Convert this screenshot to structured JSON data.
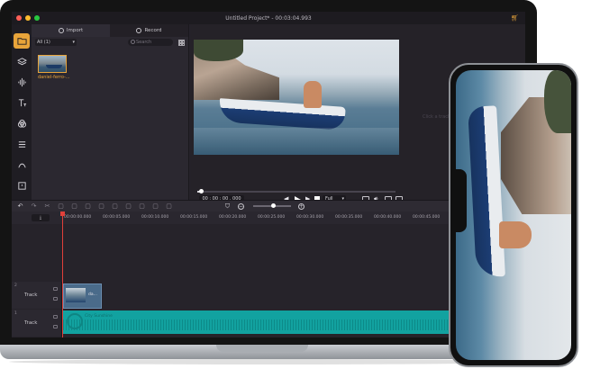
{
  "window": {
    "title": "Untitled Project* - 00:03:04.993"
  },
  "rail": {
    "items": [
      "folder-icon",
      "layers-icon",
      "audio-icon",
      "text-icon",
      "filters-icon",
      "transitions-icon",
      "elements-icon",
      "sticker-icon",
      "template-icon"
    ]
  },
  "media": {
    "tabs": [
      {
        "label": "Import"
      },
      {
        "label": "Record"
      }
    ],
    "filter": "All (1)",
    "search_placeholder": "Search",
    "clip_name": "daniel-ferro-..."
  },
  "preview": {
    "side_hint": "Click a track...",
    "timecode": "00 : 00 : 00 . 000",
    "zoom": "Full",
    "progress": 0.02
  },
  "timeline": {
    "ruler_button": "⤓",
    "ticks": [
      "00:00:00.000",
      "00:00:05.000",
      "00:00:10.000",
      "00:00:15.000",
      "00:00:20.000",
      "00:00:25.000",
      "00:00:30.000",
      "00:00:35.000",
      "00:00:40.000",
      "00:00:45.000"
    ],
    "tracks": [
      {
        "num": "2",
        "label": "Track"
      },
      {
        "num": "1",
        "label": "Track"
      }
    ],
    "video_clip_name": "da...",
    "audio_clip_name": "City Sunshine"
  },
  "colors": {
    "accent": "#e8a43a",
    "audio_clip": "#12a2a0",
    "playhead": "#e0403a"
  }
}
